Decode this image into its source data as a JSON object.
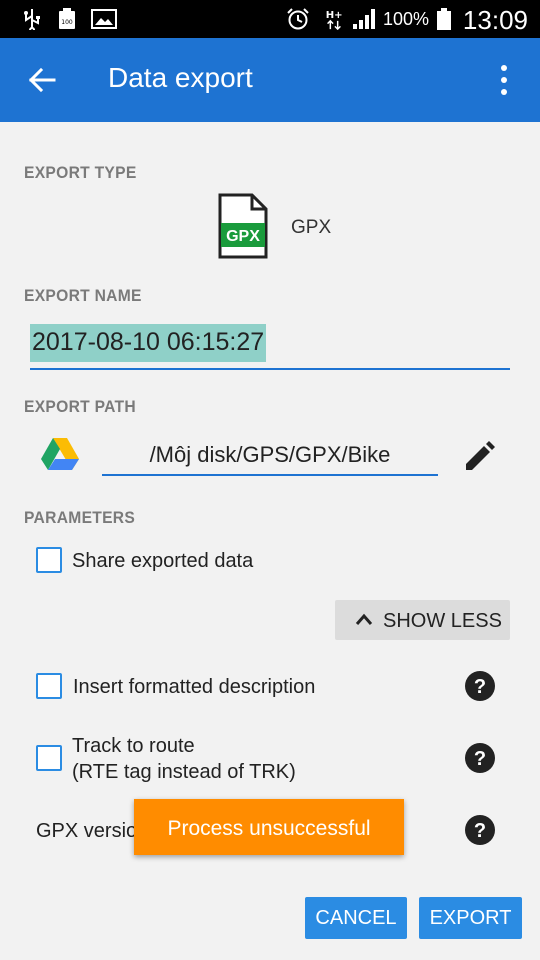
{
  "status_bar": {
    "icons": [
      "usb-icon",
      "battery-saver-icon",
      "image-icon",
      "alarm-icon",
      "hplus-data-icon",
      "signal-icon",
      "battery-icon"
    ],
    "network_type": "H+",
    "battery_percent": "100%",
    "time": "13:09"
  },
  "app_bar": {
    "title": "Data export",
    "back_icon": "arrow-back-icon",
    "menu_icon": "more-vert-icon",
    "color": "#1e73d2"
  },
  "export_type": {
    "label": "EXPORT TYPE",
    "icon_text": "GPX",
    "value": "GPX"
  },
  "export_name": {
    "label": "EXPORT NAME",
    "value": "2017-08-10 06:15:27"
  },
  "export_path": {
    "label": "EXPORT PATH",
    "value": "/Môj disk/GPS/GPX/Bike"
  },
  "parameters": {
    "label": "PARAMETERS",
    "share": {
      "label": "Share exported data",
      "checked": false
    },
    "show_less": "SHOW LESS",
    "insert_description": {
      "label": "Insert formatted description",
      "checked": false
    },
    "track_to_route": {
      "line1": "Track to route",
      "line2": "(RTE tag instead of TRK)",
      "checked": false
    },
    "gpx_version": {
      "label": "GPX versio"
    }
  },
  "toast": {
    "message": "Process unsuccessful",
    "color": "#ff8c00"
  },
  "buttons": {
    "cancel": "CANCEL",
    "export": "EXPORT",
    "color": "#2b8ce3"
  }
}
